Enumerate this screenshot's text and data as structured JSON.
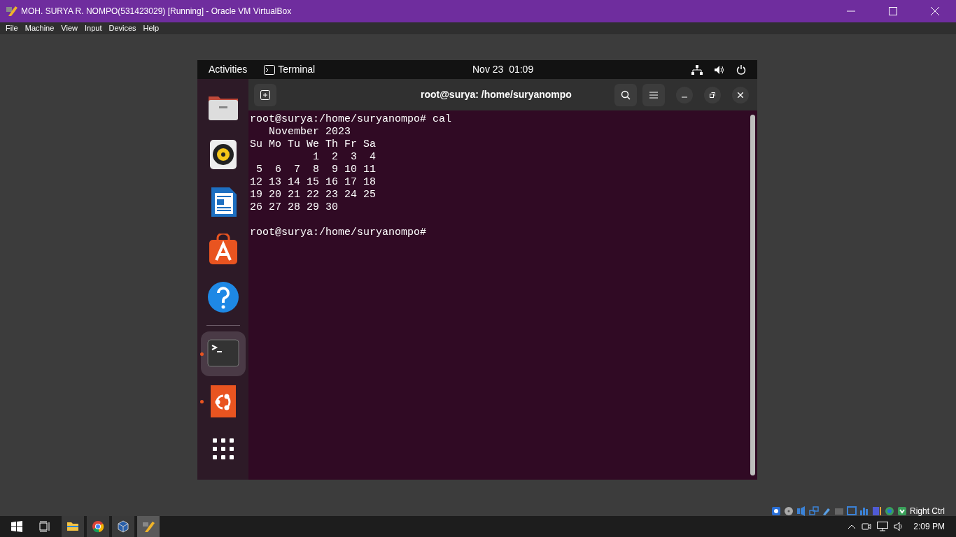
{
  "window": {
    "title": "MOH. SURYA R. NOMPO(531423029) [Running] - Oracle VM VirtualBox"
  },
  "menu": [
    "File",
    "Machine",
    "View",
    "Input",
    "Devices",
    "Help"
  ],
  "guest": {
    "topbar": {
      "activities": "Activities",
      "app": "Terminal",
      "clock": "Nov 23  01:09"
    },
    "dock": [
      {
        "kind": "files",
        "running": false,
        "selected": false
      },
      {
        "kind": "music",
        "running": false,
        "selected": false
      },
      {
        "kind": "writer",
        "running": false,
        "selected": false
      },
      {
        "kind": "store",
        "running": false,
        "selected": false
      },
      {
        "kind": "help",
        "running": false,
        "selected": false
      },
      {
        "kind": "separator"
      },
      {
        "kind": "terminal",
        "running": true,
        "selected": true
      },
      {
        "kind": "ubuntu",
        "running": true,
        "selected": false
      },
      {
        "kind": "grid",
        "running": false,
        "selected": false
      }
    ],
    "terminal": {
      "title": "root@surya: /home/suryanompo",
      "command": "root@surya:/home/suryanompo# cal",
      "output": [
        "   November 2023",
        "Su Mo Tu We Th Fr Sa",
        "          1  2  3  4",
        " 5  6  7  8  9 10 11",
        "12 13 14 15 16 17 18",
        "19 20 21 22 23 24 25",
        "26 27 28 29 30"
      ],
      "prompt": "root@surya:/home/suryanompo#"
    }
  },
  "status_bar": {
    "host_key": "Right Ctrl"
  },
  "taskbar": {
    "items": [
      {
        "kind": "explorer",
        "selected": false
      },
      {
        "kind": "chrome",
        "selected": false
      },
      {
        "kind": "virtualbox",
        "selected": false
      },
      {
        "kind": "vm",
        "selected": true
      }
    ],
    "clock": "2:09 PM"
  }
}
